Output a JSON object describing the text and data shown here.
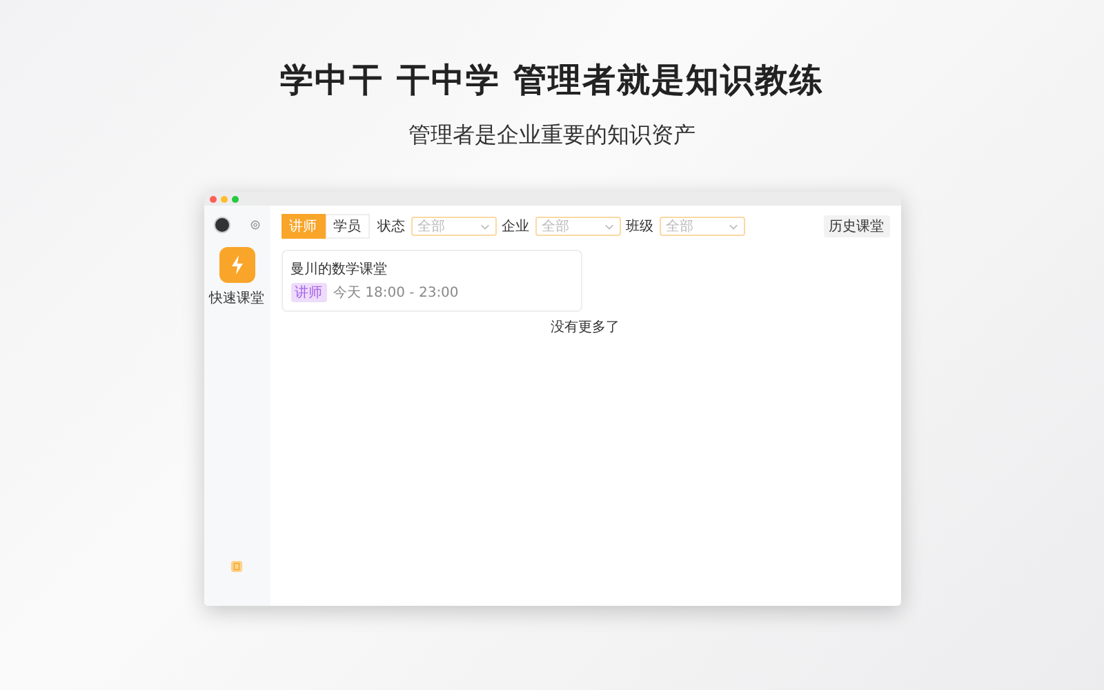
{
  "headline": "学中干 干中学 管理者就是知识教练",
  "subheadline": "管理者是企业重要的知识资产",
  "window": {
    "sidebar": {
      "quick_label": "快速课堂"
    },
    "tabs": [
      {
        "label": "讲师",
        "selected": true
      },
      {
        "label": "学员",
        "selected": false
      }
    ],
    "filters": [
      {
        "label": "状态",
        "placeholder": "全部"
      },
      {
        "label": "企业",
        "placeholder": "全部"
      },
      {
        "label": "班级",
        "placeholder": "全部"
      }
    ],
    "history_button": "历史课堂",
    "classes": [
      {
        "title": "曼川的数学课堂",
        "role": "讲师",
        "time": "今天 18:00 - 23:00"
      }
    ],
    "end_note": "没有更多了"
  }
}
